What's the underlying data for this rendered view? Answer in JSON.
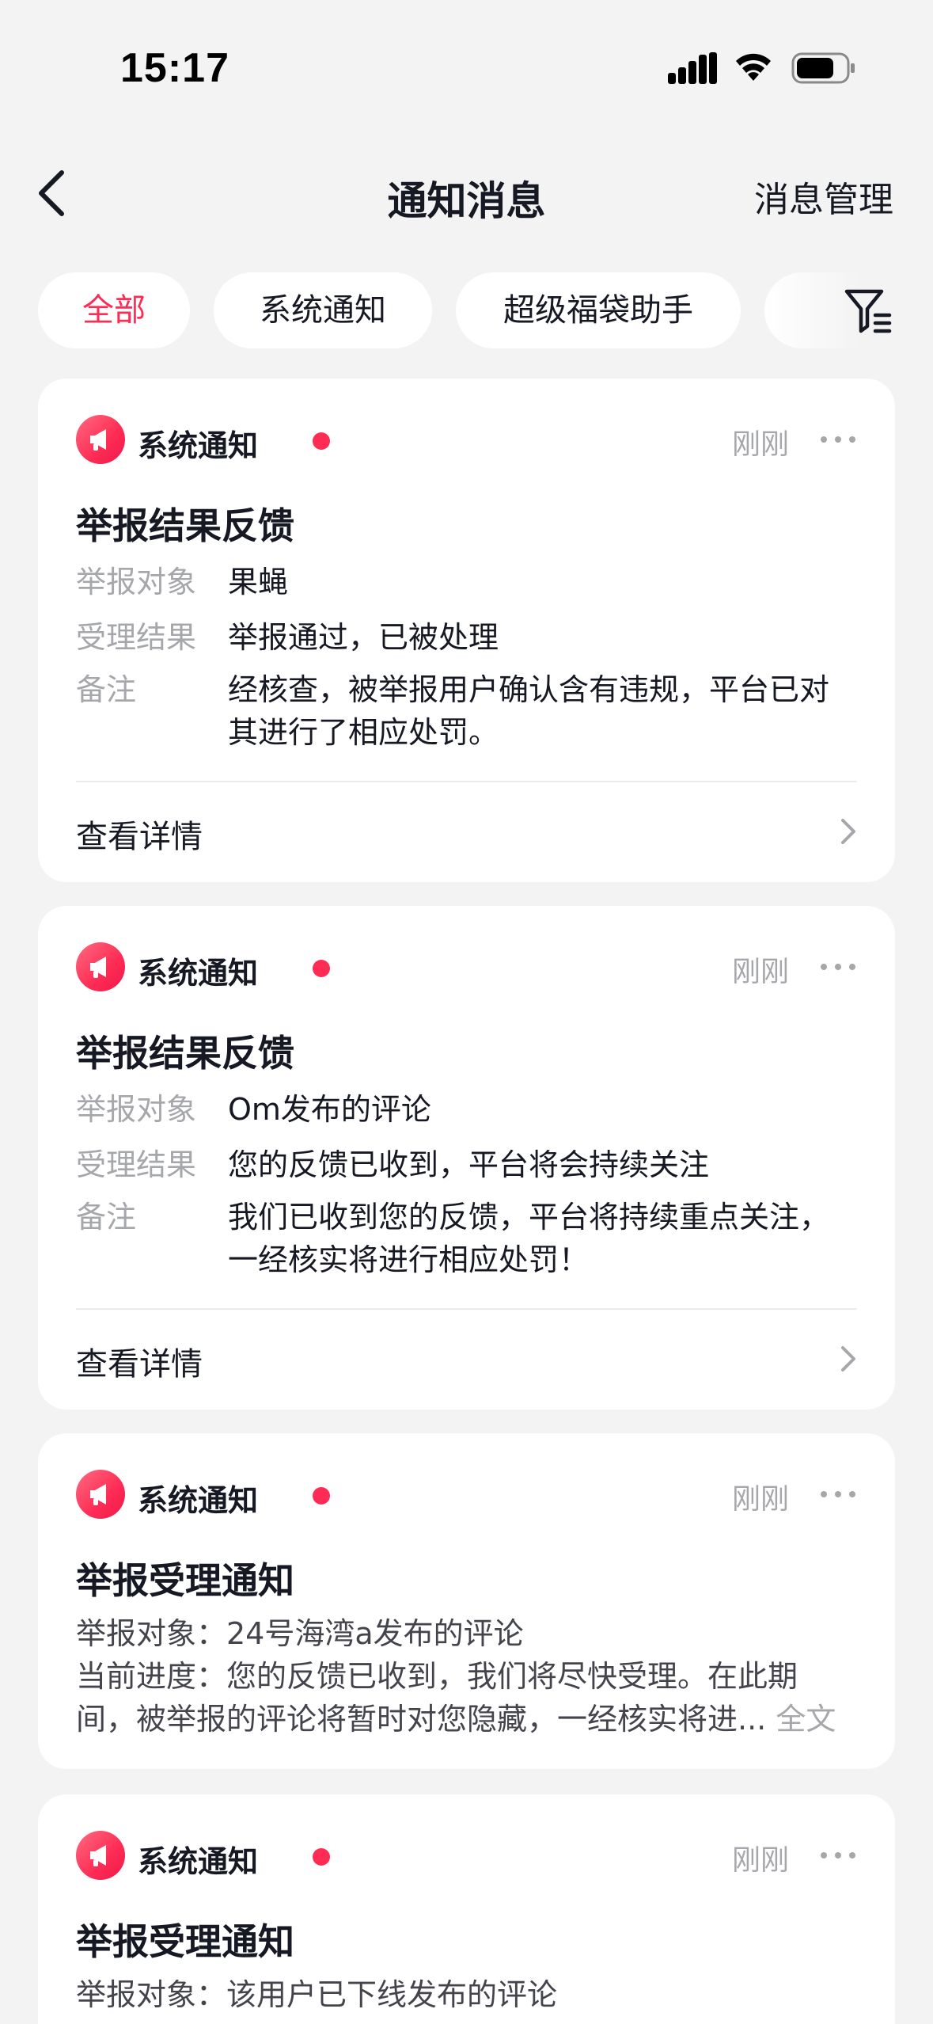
{
  "status_bar": {
    "time": "15:17"
  },
  "nav": {
    "title": "通知消息",
    "manage_label": "消息管理"
  },
  "tabs": [
    {
      "label": "全部",
      "active": true
    },
    {
      "label": "系统通知",
      "active": false
    },
    {
      "label": "超级福袋助手",
      "active": false
    }
  ],
  "colors": {
    "accent": "#fe2c55",
    "muted": "#a6a7ab",
    "bg": "#f3f3f3"
  },
  "cards": [
    {
      "source": "系统通知",
      "time": "刚刚",
      "title": "举报结果反馈",
      "rows": [
        {
          "label": "举报对象",
          "value": "果蝇"
        },
        {
          "label": "受理结果",
          "value": "举报通过，已被处理"
        },
        {
          "label": "备注",
          "value": "经核查，被举报用户确认含有违规，平台已对其进行了相应处罚。"
        }
      ],
      "detail": "查看详情"
    },
    {
      "source": "系统通知",
      "time": "刚刚",
      "title": "举报结果反馈",
      "rows": [
        {
          "label": "举报对象",
          "value": "Om发布的评论"
        },
        {
          "label": "受理结果",
          "value": "您的反馈已收到，平台将会持续关注"
        },
        {
          "label": "备注",
          "value": "我们已收到您的反馈，平台将持续重点关注，一经核实将进行相应处罚！"
        }
      ],
      "detail": "查看详情"
    },
    {
      "source": "系统通知",
      "time": "刚刚",
      "title": "举报受理通知",
      "lines": [
        "举报对象：24号海湾a发布的评论",
        "当前进度：您的反馈已收到，我们将尽快受理。在此期",
        "间，被举报的评论将暂时对您隐藏，一经核实将进..."
      ],
      "fulltext": "全文"
    },
    {
      "source": "系统通知",
      "time": "刚刚",
      "title": "举报受理通知",
      "lines": [
        "举报对象：该用户已下线发布的评论"
      ]
    }
  ]
}
